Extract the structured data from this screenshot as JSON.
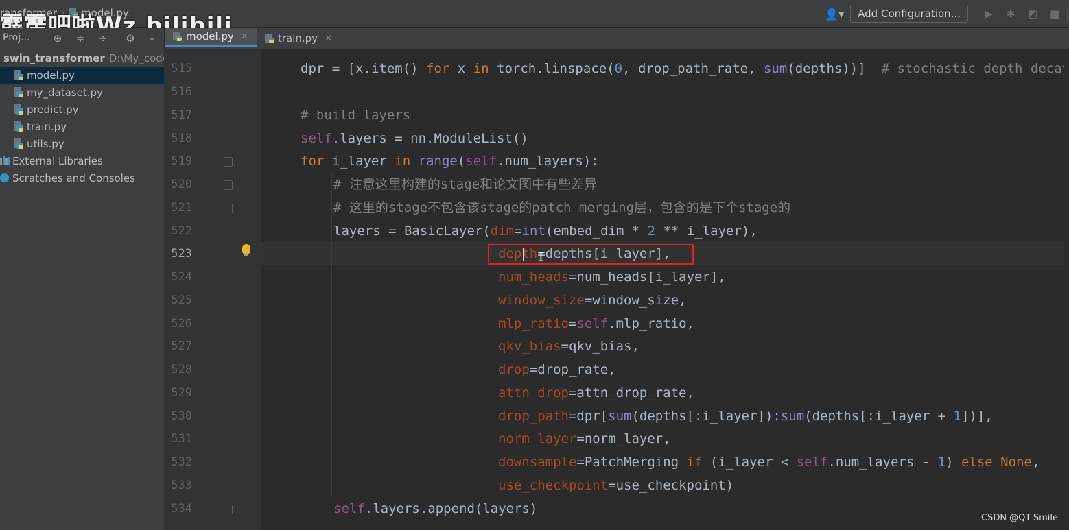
{
  "breadcrumb": {
    "project": "ransformer",
    "file": "model.py"
  },
  "watermark": "霹雳吧啦Wz bilibili",
  "toolbar": {
    "add_configuration": "Add Configuration...",
    "icons": [
      "user-icon",
      "run-icon",
      "debug-icon",
      "coverage-icon",
      "stop-icon"
    ]
  },
  "project_panel": {
    "label": "Proj..."
  },
  "tabs": [
    {
      "label": "model.py",
      "active": true
    },
    {
      "label": "train.py",
      "active": false
    }
  ],
  "tree": {
    "root": {
      "name": "swin_transformer",
      "path": "D:\\My_code"
    },
    "files": [
      "model.py",
      "my_dataset.py",
      "predict.py",
      "train.py",
      "utils.py"
    ],
    "external_libraries": "External Libraries",
    "scratches": "Scratches and Consoles"
  },
  "editor": {
    "current_line": 523,
    "line_numbers": [
      "515",
      "516",
      "517",
      "518",
      "519",
      "520",
      "521",
      "522",
      "523",
      "524",
      "525",
      "526",
      "527",
      "528",
      "529",
      "530",
      "531",
      "532",
      "533",
      "534"
    ],
    "highlight_color": "#e02222"
  },
  "footer_watermark": "CSDN @QT-Smile"
}
